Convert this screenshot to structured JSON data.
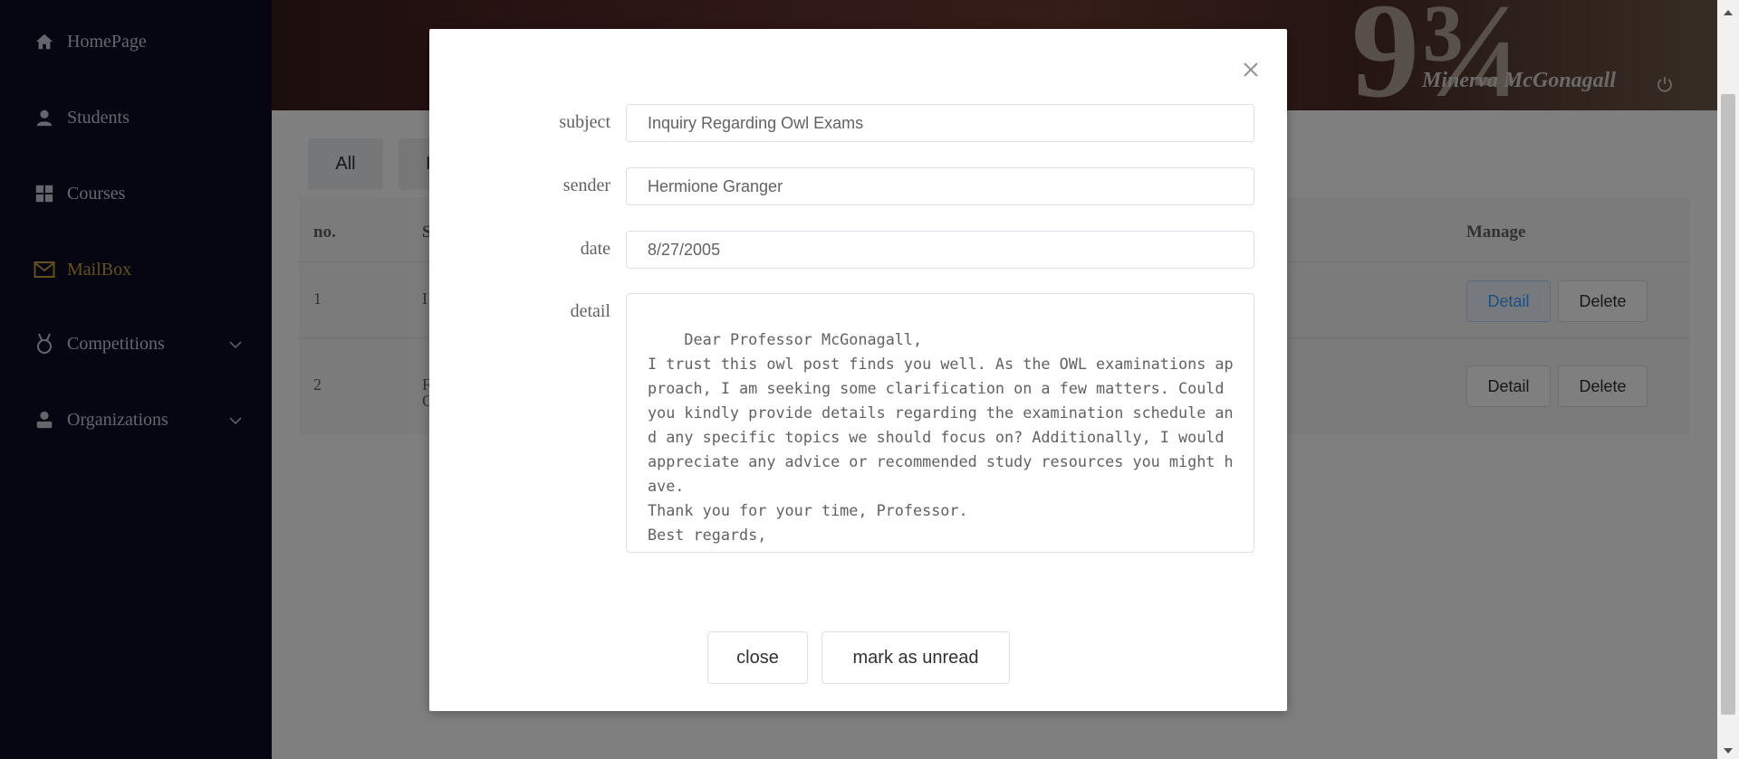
{
  "sidebar": {
    "items": [
      {
        "label": "HomePage",
        "icon": "home-icon"
      },
      {
        "label": "Students",
        "icon": "user-icon"
      },
      {
        "label": "Courses",
        "icon": "grid-icon"
      },
      {
        "label": "MailBox",
        "icon": "mail-icon",
        "active": true
      },
      {
        "label": "Competitions",
        "icon": "medal-icon",
        "expandable": true
      },
      {
        "label": "Organizations",
        "icon": "person-icon",
        "expandable": true
      }
    ],
    "active_color": "#c9a03b"
  },
  "header": {
    "user_name": "Minerva McGonagall",
    "banner_text": "9¾",
    "power_icon": "power-icon"
  },
  "filters": {
    "all_label": "All",
    "second_label_partial": "I"
  },
  "table": {
    "headers": {
      "no": "no.",
      "subject_partial": "S",
      "manage": "Manage"
    },
    "rows": [
      {
        "no": "1",
        "subject_partial": "I",
        "detail_label": "Detail",
        "delete_label": "Delete"
      },
      {
        "no": "2",
        "subject_partial_line1": "F",
        "subject_partial_line2": "C",
        "detail_label": "Detail",
        "delete_label": "Delete"
      }
    ]
  },
  "dialog": {
    "subject_label": "subject",
    "subject_value": "Inquiry Regarding Owl Exams",
    "sender_label": "sender",
    "sender_value": "Hermione Granger",
    "date_label": "date",
    "date_value": "8/27/2005",
    "detail_label": "detail",
    "detail_value": "Dear Professor McGonagall,\nI trust this owl post finds you well. As the OWL examinations approach, I am seeking some clarification on a few matters. Could you kindly provide details regarding the examination schedule and any specific topics we should focus on? Additionally, I would appreciate any advice or recommended study resources you might have.\nThank you for your time, Professor.\nBest regards,\nHermione Granger",
    "close_label": "close",
    "mark_unread_label": "mark as unread"
  }
}
